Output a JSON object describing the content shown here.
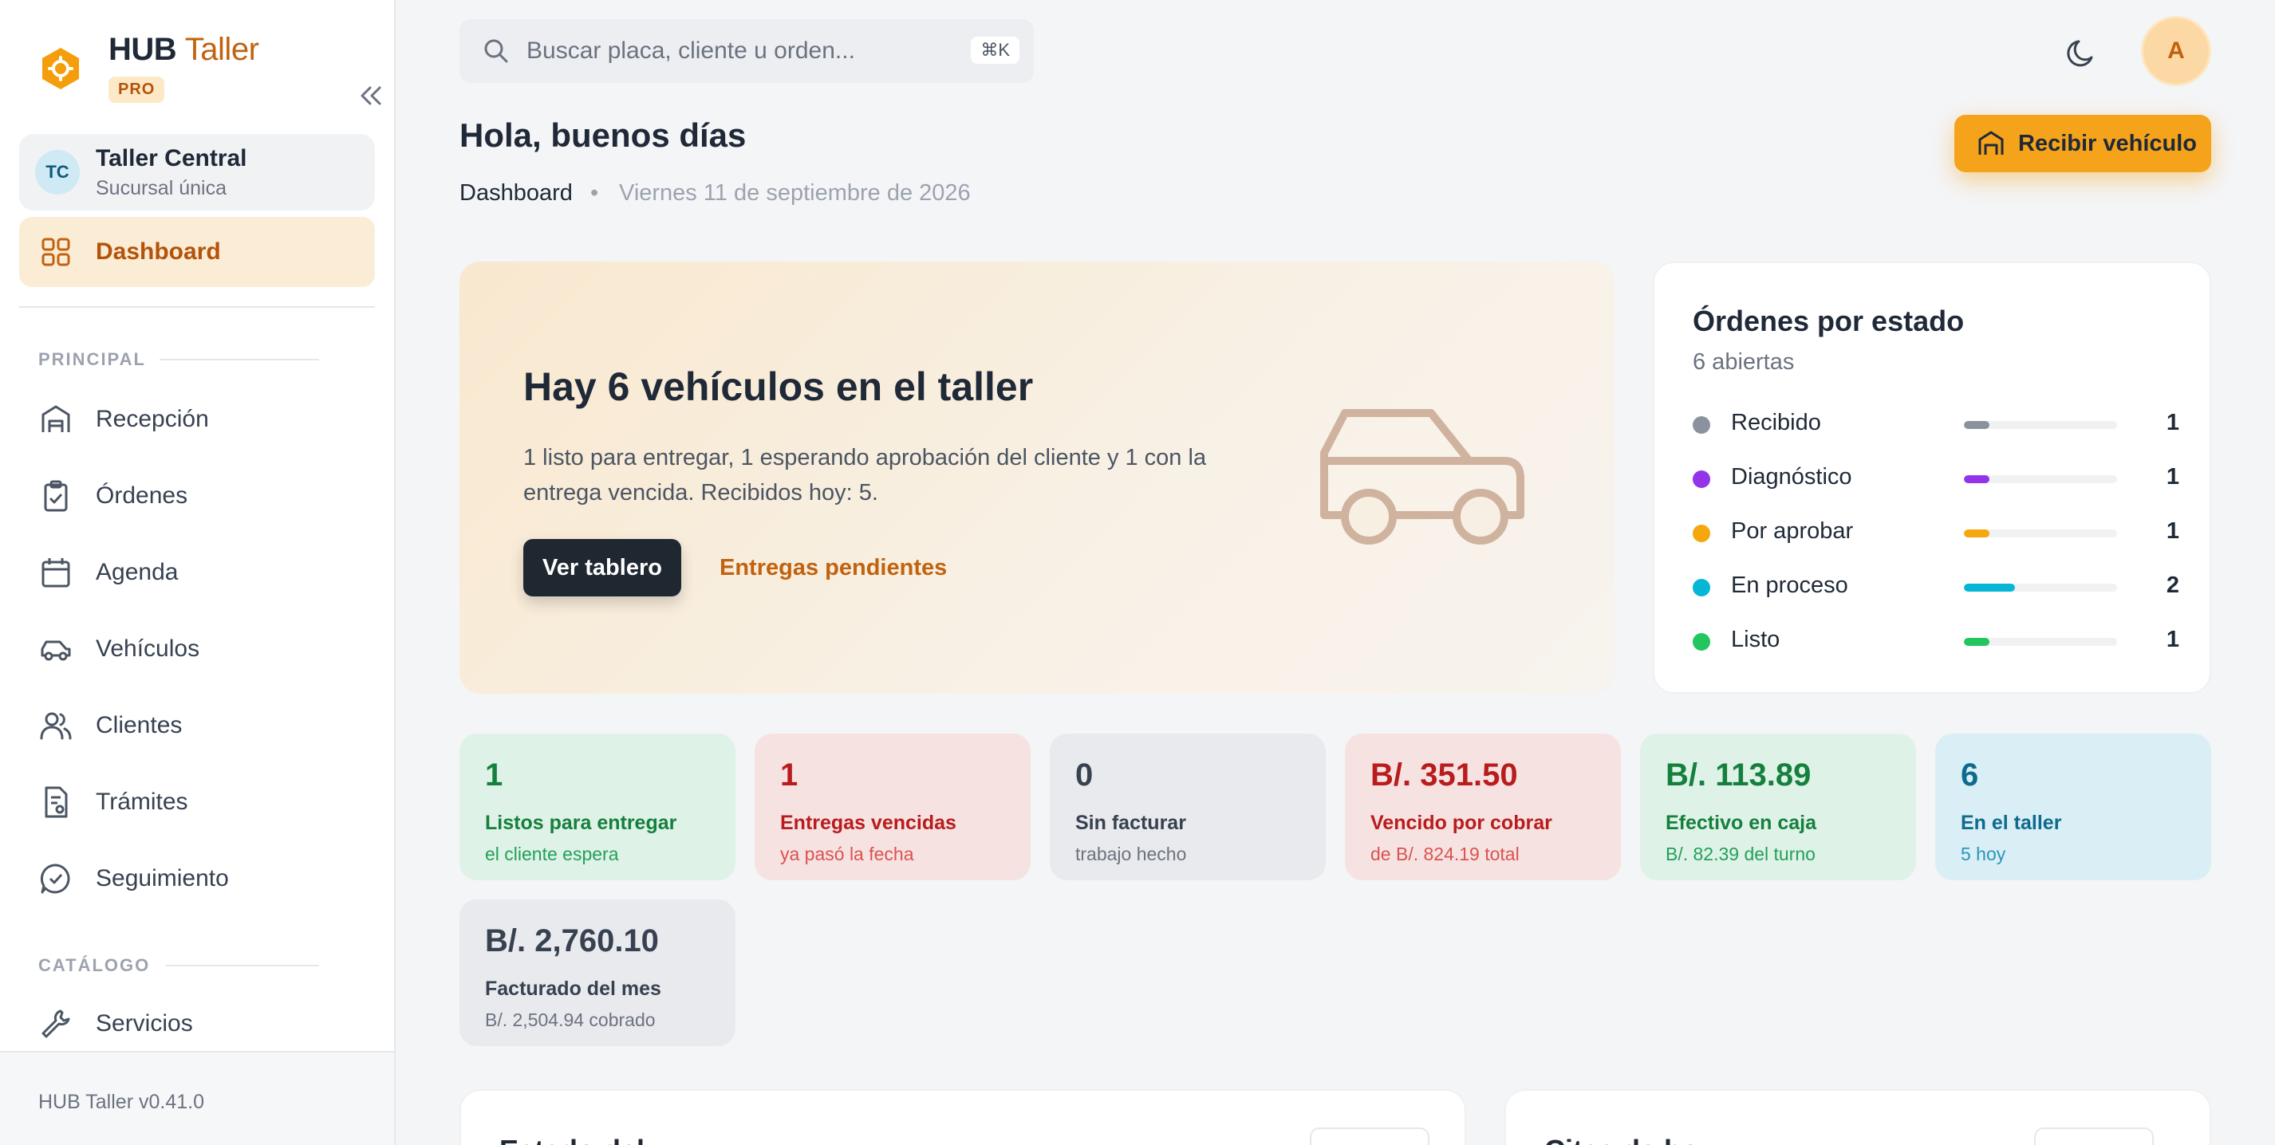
{
  "brand": {
    "hub": "HUB",
    "taller": "Taller",
    "badge": "PRO"
  },
  "branch": {
    "initials": "TC",
    "name": "Taller Central",
    "subtitle": "Sucursal única"
  },
  "nav": {
    "active": {
      "label": "Dashboard",
      "icon": "grid-icon"
    },
    "principal_label": "PRINCIPAL",
    "principal_items": [
      {
        "label": "Recepción",
        "icon": "garage-icon"
      },
      {
        "label": "Órdenes",
        "icon": "clipboard-check-icon"
      },
      {
        "label": "Agenda",
        "icon": "calendar-icon"
      },
      {
        "label": "Vehículos",
        "icon": "car-icon"
      },
      {
        "label": "Clientes",
        "icon": "users-icon"
      },
      {
        "label": "Trámites",
        "icon": "document-icon"
      },
      {
        "label": "Seguimiento",
        "icon": "chat-check-icon"
      }
    ],
    "catalog_label": "CATÁLOGO",
    "catalog_items": [
      {
        "label": "Servicios",
        "icon": "wrench-icon"
      }
    ]
  },
  "footer": {
    "version": "HUB Taller v0.41.0"
  },
  "topbar": {
    "search_placeholder": "Buscar placa, cliente u orden...",
    "search_value": "",
    "shortcut": "⌘K",
    "user_initial": "A"
  },
  "header": {
    "greeting": "Hola, buenos días",
    "breadcrumb": "Dashboard",
    "separator": "•",
    "date": "Viernes 11 de septiembre de 2026",
    "primary_action": "Recibir vehículo"
  },
  "hero": {
    "title": "Hay 6 vehículos en el taller",
    "description": "1 listo para entregar, 1 esperando aprobación del cliente y 1 con la entrega vencida. Recibidos hoy: 5.",
    "primary_button": "Ver tablero",
    "link": "Entregas pendientes"
  },
  "orders": {
    "title": "Órdenes por estado",
    "subtitle": "6 abiertas",
    "statuses": [
      {
        "label": "Recibido",
        "count": "1",
        "fraction": 0.167,
        "color": "#8a939d"
      },
      {
        "label": "Diagnóstico",
        "count": "1",
        "fraction": 0.167,
        "color": "#9333ea"
      },
      {
        "label": "Por aprobar",
        "count": "1",
        "fraction": 0.167,
        "color": "#f5a70b"
      },
      {
        "label": "En proceso",
        "count": "2",
        "fraction": 0.333,
        "color": "#06b6d4"
      },
      {
        "label": "Listo",
        "count": "1",
        "fraction": 0.167,
        "color": "#22c55e"
      }
    ]
  },
  "stats": [
    {
      "value": "1",
      "label": "Listos para entregar",
      "sub": "el cliente espera",
      "tone": "green"
    },
    {
      "value": "1",
      "label": "Entregas vencidas",
      "sub": "ya pasó la fecha",
      "tone": "red"
    },
    {
      "value": "0",
      "label": "Sin facturar",
      "sub": "trabajo hecho",
      "tone": "gray"
    },
    {
      "value": "B/. 351.50",
      "label": "Vencido por cobrar",
      "sub": "de B/. 824.19 total",
      "tone": "red"
    },
    {
      "value": "B/. 113.89",
      "label": "Efectivo en caja",
      "sub": "B/. 82.39 del turno",
      "tone": "green"
    },
    {
      "value": "6",
      "label": "En el taller",
      "sub": "5 hoy",
      "tone": "blue"
    },
    {
      "value": "B/. 2,760.10",
      "label": "Facturado del mes",
      "sub": "B/. 2,504.94 cobrado",
      "tone": "gray"
    }
  ],
  "bottom_cards": [
    {
      "title": "Estado del..."
    },
    {
      "title": "Citas de hoy"
    }
  ],
  "colors": {
    "accent": "#f5a31a",
    "brand_orange": "#c2620f",
    "dark_button": "#1f2731"
  }
}
